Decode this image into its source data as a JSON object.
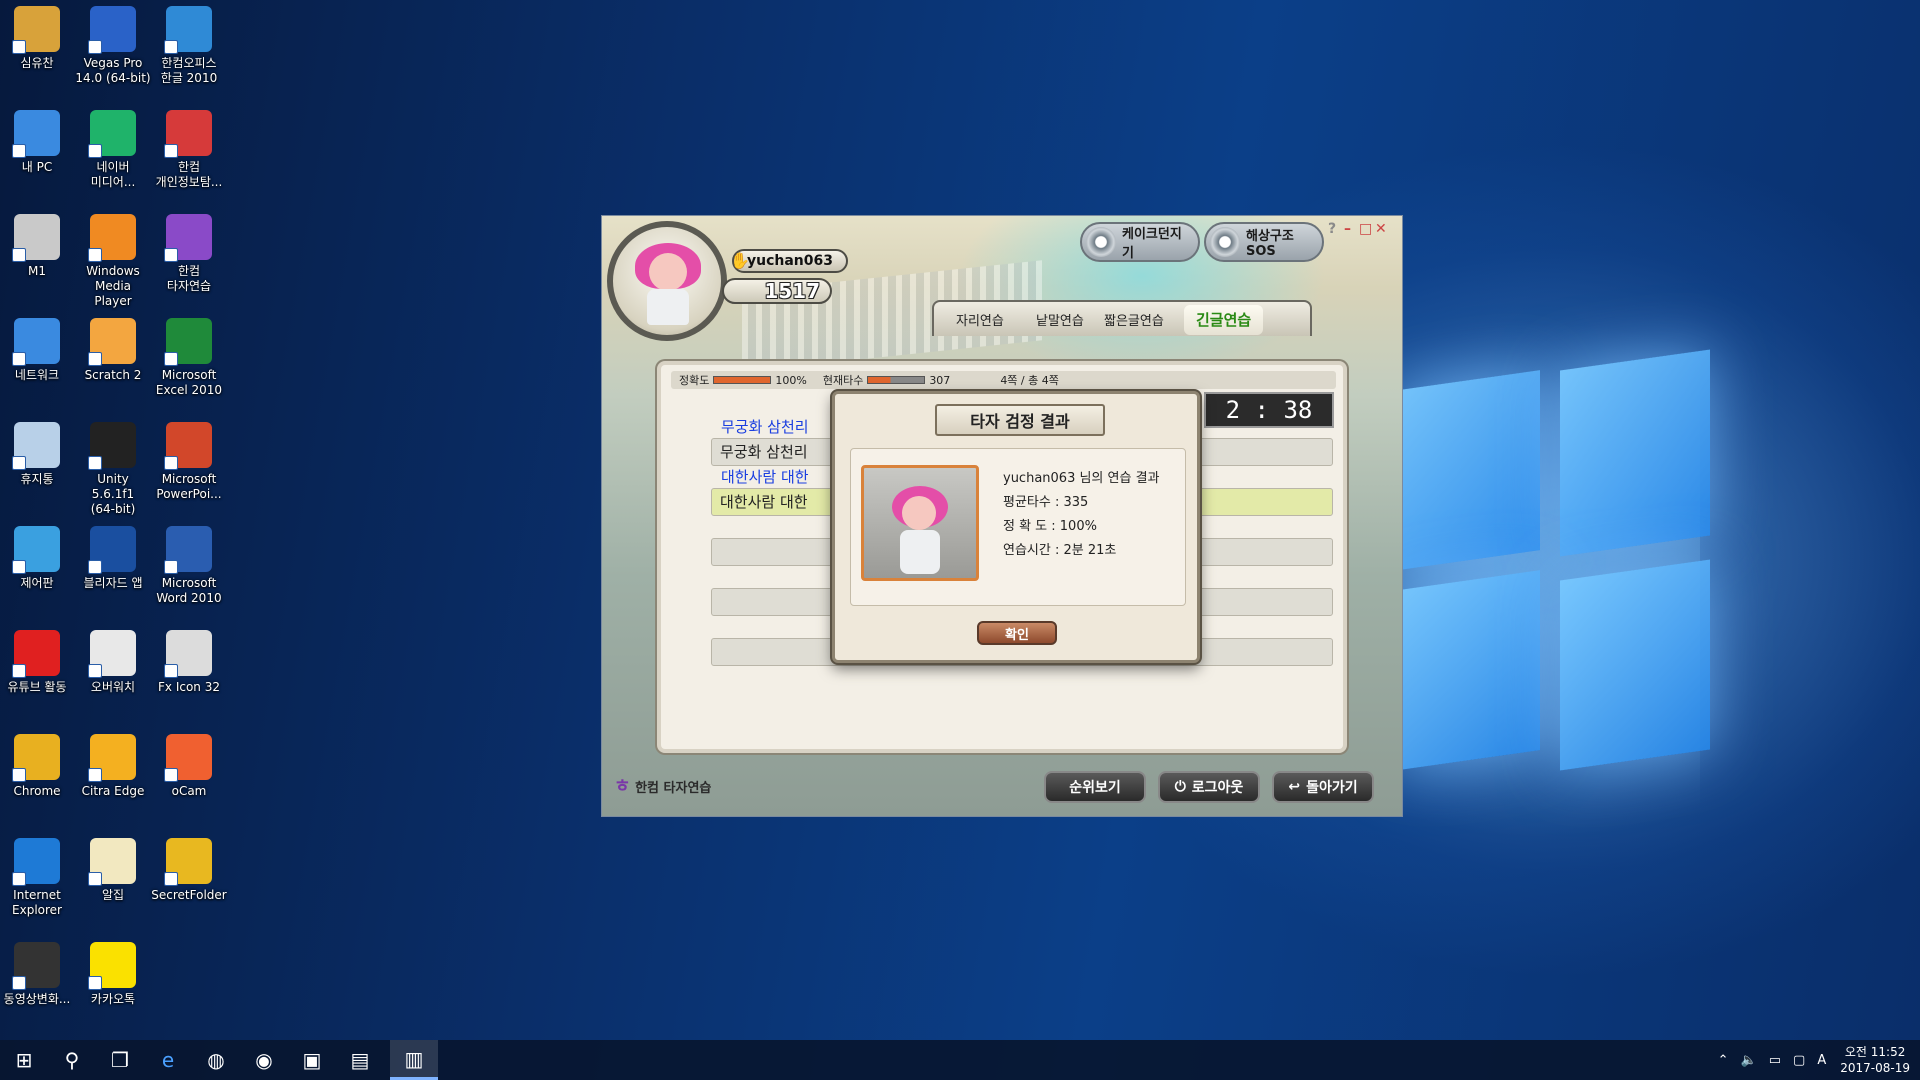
{
  "desktop": {
    "icons": [
      {
        "label": "심유찬",
        "color": "#d8a23a"
      },
      {
        "label": "Vegas Pro\n14.0 (64-bit)",
        "color": "#2a62c8"
      },
      {
        "label": "한컴오피스\n한글 2010",
        "color": "#2f8ad6"
      },
      {
        "label": "내 PC",
        "color": "#3a8ae0"
      },
      {
        "label": "네이버\n미디어...",
        "color": "#1fb36a"
      },
      {
        "label": "한컴\n개인정보탐...",
        "color": "#d63a3a"
      },
      {
        "label": "M1",
        "color": "#c9c9c9"
      },
      {
        "label": "Windows\nMedia Player",
        "color": "#f08a22"
      },
      {
        "label": "한컴\n타자연습",
        "color": "#8a4ac8"
      },
      {
        "label": "네트워크",
        "color": "#3a8ae0"
      },
      {
        "label": "Scratch 2",
        "color": "#f3a640"
      },
      {
        "label": "Microsoft\nExcel 2010",
        "color": "#1f8a3a"
      },
      {
        "label": "휴지통",
        "color": "#b8d0e8"
      },
      {
        "label": "Unity 5.6.1f1\n(64-bit)",
        "color": "#222222"
      },
      {
        "label": "Microsoft\nPowerPoi...",
        "color": "#d2472a"
      },
      {
        "label": "제어판",
        "color": "#3aa0e0"
      },
      {
        "label": "블리자드 앱",
        "color": "#1a4fa0"
      },
      {
        "label": "Microsoft\nWord 2010",
        "color": "#2a5db0"
      },
      {
        "label": "유튜브 활동",
        "color": "#e02020"
      },
      {
        "label": "오버워치",
        "color": "#e8e8e8"
      },
      {
        "label": "Fx Icon 32",
        "color": "#dcdcdc"
      },
      {
        "label": "Chrome",
        "color": "#e8b020"
      },
      {
        "label": "Citra Edge",
        "color": "#f4b020"
      },
      {
        "label": "oCam",
        "color": "#f06030"
      },
      {
        "label": "Internet\nExplorer",
        "color": "#1e7ad6"
      },
      {
        "label": "알집",
        "color": "#f2e8c0"
      },
      {
        "label": "SecretFolder",
        "color": "#e8b820"
      },
      {
        "label": "동영상변화...",
        "color": "#333333"
      },
      {
        "label": "카카오톡",
        "color": "#fae100"
      }
    ]
  },
  "game": {
    "username": "yuchan063",
    "score": "1517",
    "top_buttons": {
      "kayak": "케이크던지기",
      "rescue": "해상구조SOS"
    },
    "window_controls": {
      "help": "?",
      "min": "–",
      "max": "□",
      "close": "✕"
    },
    "tabs": [
      "자리연습",
      "낱말연습",
      "짧은글연습",
      "긴글연습"
    ],
    "active_tab": "긴글연습",
    "stats": {
      "accuracy_label": "정확도",
      "accuracy_value": "100%",
      "speed_label": "현재타수",
      "speed_value": "307",
      "page": "4쪽 / 총 4쪽",
      "accuracy_fraction": 1.0,
      "speed_fraction": 0.4
    },
    "timer": "2 : 38",
    "lines": [
      {
        "source": "무궁화 삼천리",
        "typed": "무궁화 삼천리"
      },
      {
        "source": "대한사람 대한",
        "typed": "대한사람 대한"
      },
      {
        "source": "",
        "typed": ""
      },
      {
        "source": "",
        "typed": ""
      },
      {
        "source": "",
        "typed": ""
      }
    ],
    "logo": "한컴 타자연습",
    "bottom_buttons": {
      "ranking": "순위보기",
      "logout": "로그아웃",
      "back": "돌아가기"
    }
  },
  "dialog": {
    "title": "타자 검정 결과",
    "heading": "yuchan063 님의 연습 결과",
    "avg_speed": "평균타수 : 335",
    "accuracy": "정 확 도 : 100%",
    "time": "연습시간 : 2분 21초",
    "ok": "확인"
  },
  "taskbar": {
    "clock_time": "오전 11:52",
    "clock_date": "2017-08-19",
    "ime": "A"
  }
}
